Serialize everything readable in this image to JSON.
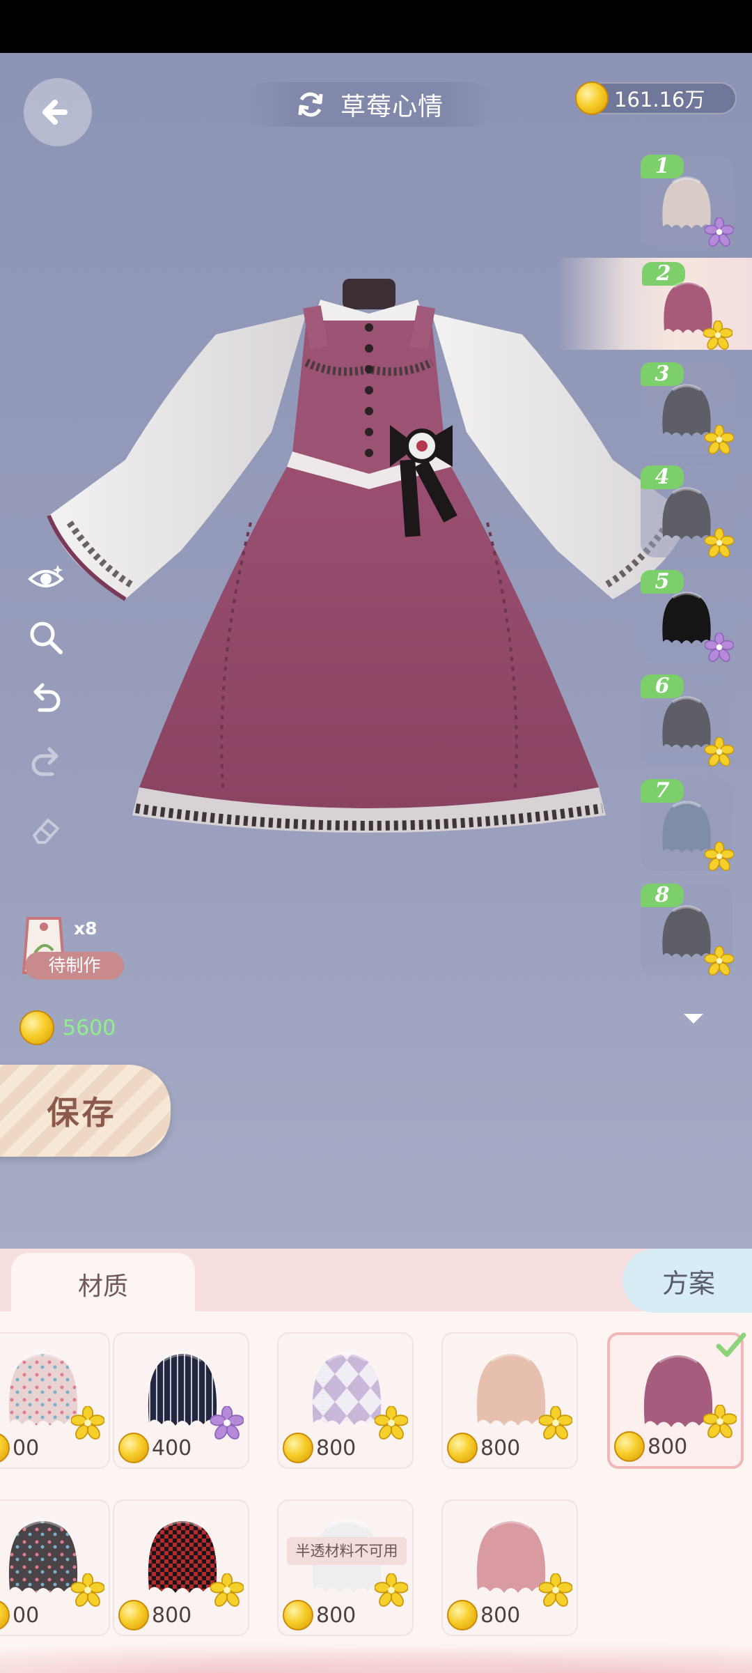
{
  "header": {
    "title": "草莓心情",
    "currency": "161.16万"
  },
  "left_panel": {
    "pattern_count": "x8",
    "pattern_status": "待制作",
    "cost": "5600",
    "save_label": "保存"
  },
  "layers": [
    {
      "num": "1",
      "color": "#d8cbc8",
      "star": "purple-flower"
    },
    {
      "num": "2",
      "color": "#a85a7a",
      "star": "gold-star",
      "active": true
    },
    {
      "num": "3",
      "color": "#5e5e66",
      "star": "gold-star"
    },
    {
      "num": "4",
      "color": "#5e5e66",
      "star": "gold-star"
    },
    {
      "num": "5",
      "color": "#151515",
      "star": "purple-flower"
    },
    {
      "num": "6",
      "color": "#5e5e66",
      "star": "gold-star"
    },
    {
      "num": "7",
      "color": "#7f8ea6",
      "star": "gold-star"
    },
    {
      "num": "8",
      "color": "#5e5e66",
      "star": "gold-star"
    }
  ],
  "tabs": {
    "material": "材质",
    "scheme": "方案"
  },
  "materials": [
    {
      "price": "00",
      "pattern": "dots-pink"
    },
    {
      "price": "400",
      "pattern": "stripes-navy"
    },
    {
      "price": "800",
      "pattern": "argyle-lilac"
    },
    {
      "price": "800",
      "pattern": "plain-peach"
    },
    {
      "price": "800",
      "pattern": "plain-mauve",
      "selected": true
    },
    {
      "price": "00",
      "pattern": "dots-dark"
    },
    {
      "price": "800",
      "pattern": "houndstooth-red"
    },
    {
      "price": "800",
      "pattern": "translucent-white",
      "tag": "半透材料不可用"
    },
    {
      "price": "800",
      "pattern": "plain-rose"
    }
  ],
  "colors": {
    "accent_green": "#7ccf6a",
    "cost_green": "#8ff08a",
    "panel_bg": "#fdf5f2"
  }
}
